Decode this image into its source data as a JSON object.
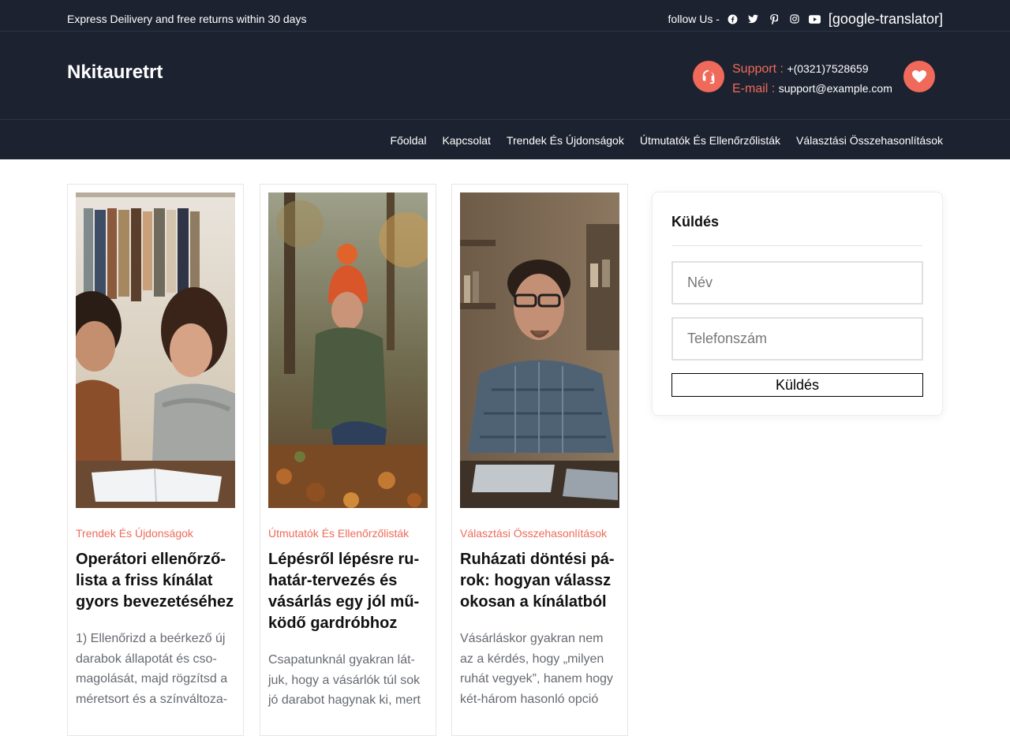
{
  "colors": {
    "dark_bg": "#1c2230",
    "accent": "#ef6a5a"
  },
  "topbar": {
    "promo": "Express Deilivery and free returns within 30 days",
    "follow_label": "follow Us -",
    "social_icons": [
      "facebook-icon",
      "twitter-icon",
      "pinterest-icon",
      "instagram-icon",
      "youtube-icon"
    ],
    "translator": "[google-translator]"
  },
  "header": {
    "logo": "Nkitauretrt",
    "support_label": "Support :",
    "support_value": "+(0321)7528659",
    "email_label": "E-mail :",
    "email_value": "support@example.com"
  },
  "nav": {
    "items": [
      "Főoldal",
      "Kapcsolat",
      "Trendek És Újdonságok",
      "Útmutatók És Ellenőrzőlisták",
      "Választási Összehasonlítások"
    ]
  },
  "posts": [
    {
      "category": "Trendek És Újdonságok",
      "title": "Operátori ellenőrző-lista a friss kínálat gyors bevezetéséhez",
      "excerpt": "1) Ellenőrizd a beérkező új darabok állapotát és cso-magolását, majd rögzítsd a méretsort és a színváltoza-"
    },
    {
      "category": "Útmutatók És Ellenőrzőlisták",
      "title": "Lépésről lépésre ru-határ-tervezés és vásárlás egy jól mű-ködő gardróbhoz",
      "excerpt": "Csapatunknál gyakran lát-juk, hogy a vásárlók túl sok jó darabot hagynak ki, mert"
    },
    {
      "category": "Választási Összehasonlítások",
      "title": "Ruházati döntési pá-rok: hogyan válassz okosan a kínálatból",
      "excerpt": "Vásárláskor gyakran nem az a kérdés, hogy „milyen ruhát vegyek”, hanem hogy két-három hasonló opció"
    }
  ],
  "sidebar": {
    "title": "Küldés",
    "name_placeholder": "Név",
    "phone_placeholder": "Telefonszám",
    "submit_label": "Küldés"
  }
}
